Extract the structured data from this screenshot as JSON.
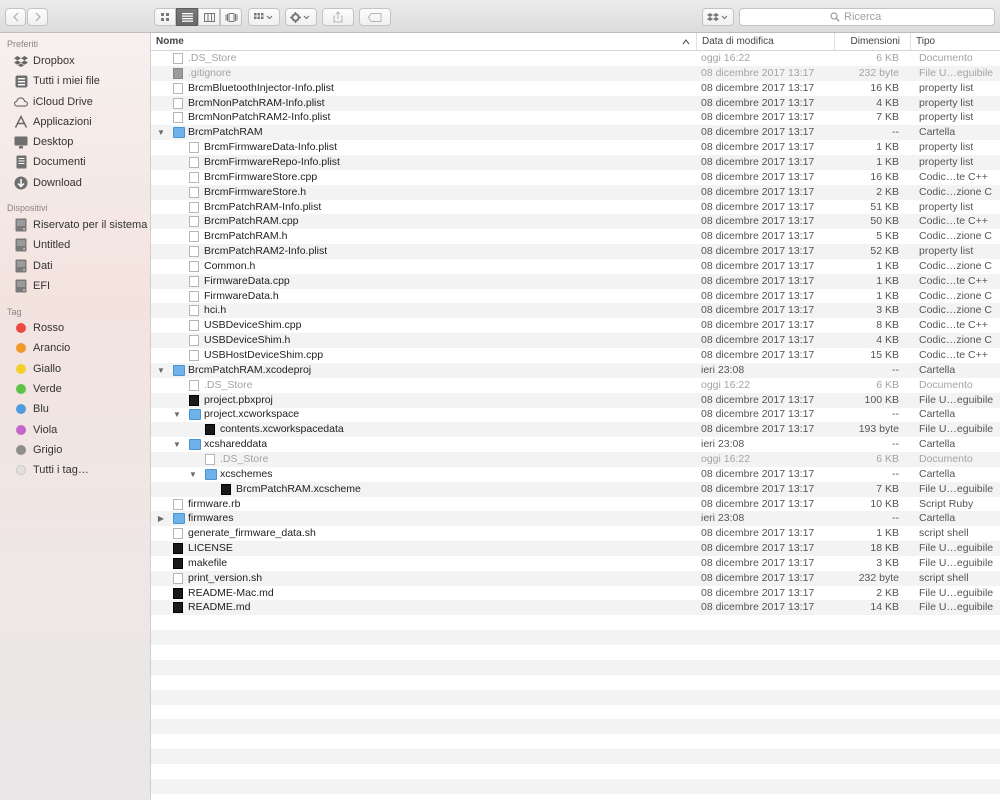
{
  "toolbar": {
    "back_icon": "chevron-left-icon",
    "forward_icon": "chevron-right-icon",
    "search_placeholder": "Ricerca"
  },
  "sidebar": {
    "sections": [
      {
        "title": "Preferiti",
        "items": [
          {
            "label": "Dropbox",
            "icon": "dropbox-icon"
          },
          {
            "label": "Tutti i miei file",
            "icon": "all-files-icon"
          },
          {
            "label": "iCloud Drive",
            "icon": "cloud-icon"
          },
          {
            "label": "Applicazioni",
            "icon": "applications-icon"
          },
          {
            "label": "Desktop",
            "icon": "desktop-icon"
          },
          {
            "label": "Documenti",
            "icon": "documents-icon"
          },
          {
            "label": "Download",
            "icon": "download-icon"
          }
        ]
      },
      {
        "title": "Dispositivi",
        "items": [
          {
            "label": "Riservato per il sistema",
            "icon": "disk-icon"
          },
          {
            "label": "Untitled",
            "icon": "disk-icon"
          },
          {
            "label": "Dati",
            "icon": "disk-icon"
          },
          {
            "label": "EFI",
            "icon": "disk-icon"
          }
        ]
      },
      {
        "title": "Tag",
        "items": [
          {
            "label": "Rosso",
            "color": "#ec4a44"
          },
          {
            "label": "Arancio",
            "color": "#f09a2b"
          },
          {
            "label": "Giallo",
            "color": "#f5cf2c"
          },
          {
            "label": "Verde",
            "color": "#5ec248"
          },
          {
            "label": "Blu",
            "color": "#4e9cde"
          },
          {
            "label": "Viola",
            "color": "#c466c9"
          },
          {
            "label": "Grigio",
            "color": "#8e8e8e"
          },
          {
            "label": "Tutti i tag…",
            "color": "#e0e0e0"
          }
        ]
      }
    ]
  },
  "columns": {
    "name": "Nome",
    "date": "Data di modifica",
    "size": "Dimensioni",
    "kind": "Tipo"
  },
  "files": [
    {
      "name": ".DS_Store",
      "date": "oggi 16:22",
      "size": "6 KB",
      "kind": "Documento",
      "depth": 0,
      "icon": "doc",
      "dim": true
    },
    {
      "name": ".gitignore",
      "date": "08 dicembre 2017 13:17",
      "size": "232 byte",
      "kind": "File U…eguibile",
      "depth": 0,
      "icon": "gray",
      "dim": true
    },
    {
      "name": "BrcmBluetoothInjector-Info.plist",
      "date": "08 dicembre 2017 13:17",
      "size": "16 KB",
      "kind": "property list",
      "depth": 0,
      "icon": "doc"
    },
    {
      "name": "BrcmNonPatchRAM-Info.plist",
      "date": "08 dicembre 2017 13:17",
      "size": "4 KB",
      "kind": "property list",
      "depth": 0,
      "icon": "doc"
    },
    {
      "name": "BrcmNonPatchRAM2-Info.plist",
      "date": "08 dicembre 2017 13:17",
      "size": "7 KB",
      "kind": "property list",
      "depth": 0,
      "icon": "doc"
    },
    {
      "name": "BrcmPatchRAM",
      "date": "08 dicembre 2017 13:17",
      "size": "--",
      "kind": "Cartella",
      "depth": 0,
      "icon": "folder",
      "disclosure": "open"
    },
    {
      "name": "BrcmFirmwareData-Info.plist",
      "date": "08 dicembre 2017 13:17",
      "size": "1 KB",
      "kind": "property list",
      "depth": 1,
      "icon": "doc"
    },
    {
      "name": "BrcmFirmwareRepo-Info.plist",
      "date": "08 dicembre 2017 13:17",
      "size": "1 KB",
      "kind": "property list",
      "depth": 1,
      "icon": "doc"
    },
    {
      "name": "BrcmFirmwareStore.cpp",
      "date": "08 dicembre 2017 13:17",
      "size": "16 KB",
      "kind": "Codic…te C++",
      "depth": 1,
      "icon": "doc"
    },
    {
      "name": "BrcmFirmwareStore.h",
      "date": "08 dicembre 2017 13:17",
      "size": "2 KB",
      "kind": "Codic…zione C",
      "depth": 1,
      "icon": "doc"
    },
    {
      "name": "BrcmPatchRAM-Info.plist",
      "date": "08 dicembre 2017 13:17",
      "size": "51 KB",
      "kind": "property list",
      "depth": 1,
      "icon": "doc"
    },
    {
      "name": "BrcmPatchRAM.cpp",
      "date": "08 dicembre 2017 13:17",
      "size": "50 KB",
      "kind": "Codic…te C++",
      "depth": 1,
      "icon": "doc"
    },
    {
      "name": "BrcmPatchRAM.h",
      "date": "08 dicembre 2017 13:17",
      "size": "5 KB",
      "kind": "Codic…zione C",
      "depth": 1,
      "icon": "doc"
    },
    {
      "name": "BrcmPatchRAM2-Info.plist",
      "date": "08 dicembre 2017 13:17",
      "size": "52 KB",
      "kind": "property list",
      "depth": 1,
      "icon": "doc"
    },
    {
      "name": "Common.h",
      "date": "08 dicembre 2017 13:17",
      "size": "1 KB",
      "kind": "Codic…zione C",
      "depth": 1,
      "icon": "doc"
    },
    {
      "name": "FirmwareData.cpp",
      "date": "08 dicembre 2017 13:17",
      "size": "1 KB",
      "kind": "Codic…te C++",
      "depth": 1,
      "icon": "doc"
    },
    {
      "name": "FirmwareData.h",
      "date": "08 dicembre 2017 13:17",
      "size": "1 KB",
      "kind": "Codic…zione C",
      "depth": 1,
      "icon": "doc"
    },
    {
      "name": "hci.h",
      "date": "08 dicembre 2017 13:17",
      "size": "3 KB",
      "kind": "Codic…zione C",
      "depth": 1,
      "icon": "doc"
    },
    {
      "name": "USBDeviceShim.cpp",
      "date": "08 dicembre 2017 13:17",
      "size": "8 KB",
      "kind": "Codic…te C++",
      "depth": 1,
      "icon": "doc"
    },
    {
      "name": "USBDeviceShim.h",
      "date": "08 dicembre 2017 13:17",
      "size": "4 KB",
      "kind": "Codic…zione C",
      "depth": 1,
      "icon": "doc"
    },
    {
      "name": "USBHostDeviceShim.cpp",
      "date": "08 dicembre 2017 13:17",
      "size": "15 KB",
      "kind": "Codic…te C++",
      "depth": 1,
      "icon": "doc"
    },
    {
      "name": "BrcmPatchRAM.xcodeproj",
      "date": "ieri 23:08",
      "size": "--",
      "kind": "Cartella",
      "depth": 0,
      "icon": "folder",
      "disclosure": "open"
    },
    {
      "name": ".DS_Store",
      "date": "oggi 16:22",
      "size": "6 KB",
      "kind": "Documento",
      "depth": 1,
      "icon": "doc",
      "dim": true
    },
    {
      "name": "project.pbxproj",
      "date": "08 dicembre 2017 13:17",
      "size": "100 KB",
      "kind": "File U…eguibile",
      "depth": 1,
      "icon": "black"
    },
    {
      "name": "project.xcworkspace",
      "date": "08 dicembre 2017 13:17",
      "size": "--",
      "kind": "Cartella",
      "depth": 1,
      "icon": "folder",
      "disclosure": "open"
    },
    {
      "name": "contents.xcworkspacedata",
      "date": "08 dicembre 2017 13:17",
      "size": "193 byte",
      "kind": "File U…eguibile",
      "depth": 2,
      "icon": "black"
    },
    {
      "name": "xcshareddata",
      "date": "ieri 23:08",
      "size": "--",
      "kind": "Cartella",
      "depth": 1,
      "icon": "folder",
      "disclosure": "open"
    },
    {
      "name": ".DS_Store",
      "date": "oggi 16:22",
      "size": "6 KB",
      "kind": "Documento",
      "depth": 2,
      "icon": "doc",
      "dim": true
    },
    {
      "name": "xcschemes",
      "date": "08 dicembre 2017 13:17",
      "size": "--",
      "kind": "Cartella",
      "depth": 2,
      "icon": "folder",
      "disclosure": "open"
    },
    {
      "name": "BrcmPatchRAM.xcscheme",
      "date": "08 dicembre 2017 13:17",
      "size": "7 KB",
      "kind": "File U…eguibile",
      "depth": 3,
      "icon": "black"
    },
    {
      "name": "firmware.rb",
      "date": "08 dicembre 2017 13:17",
      "size": "10 KB",
      "kind": "Script Ruby",
      "depth": 0,
      "icon": "doc"
    },
    {
      "name": "firmwares",
      "date": "ieri 23:08",
      "size": "--",
      "kind": "Cartella",
      "depth": 0,
      "icon": "folder",
      "disclosure": "closed"
    },
    {
      "name": "generate_firmware_data.sh",
      "date": "08 dicembre 2017 13:17",
      "size": "1 KB",
      "kind": "script shell",
      "depth": 0,
      "icon": "doc"
    },
    {
      "name": "LICENSE",
      "date": "08 dicembre 2017 13:17",
      "size": "18 KB",
      "kind": "File U…eguibile",
      "depth": 0,
      "icon": "black"
    },
    {
      "name": "makefile",
      "date": "08 dicembre 2017 13:17",
      "size": "3 KB",
      "kind": "File U…eguibile",
      "depth": 0,
      "icon": "black"
    },
    {
      "name": "print_version.sh",
      "date": "08 dicembre 2017 13:17",
      "size": "232 byte",
      "kind": "script shell",
      "depth": 0,
      "icon": "doc"
    },
    {
      "name": "README-Mac.md",
      "date": "08 dicembre 2017 13:17",
      "size": "2 KB",
      "kind": "File U…eguibile",
      "depth": 0,
      "icon": "black"
    },
    {
      "name": "README.md",
      "date": "08 dicembre 2017 13:17",
      "size": "14 KB",
      "kind": "File U…eguibile",
      "depth": 0,
      "icon": "black"
    }
  ]
}
